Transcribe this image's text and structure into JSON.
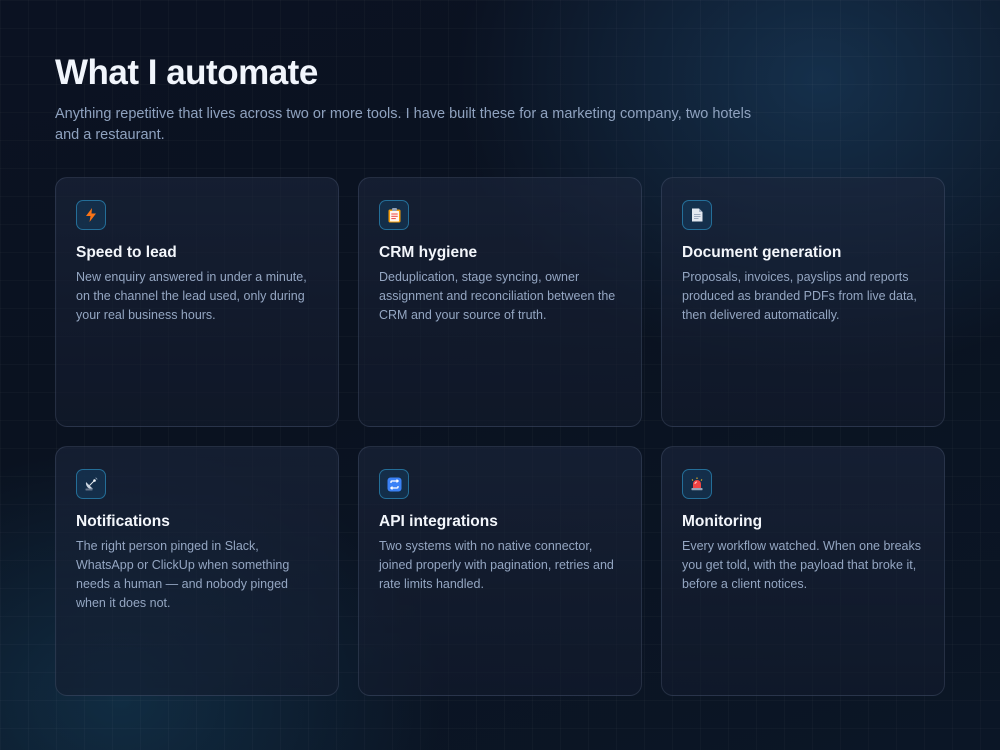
{
  "section": {
    "title": "What I automate",
    "subtitle": "Anything repetitive that lives across two or more tools. I have built these for a marketing company, two hotels and a restaurant."
  },
  "cards": [
    {
      "icon": "lightning-icon",
      "title": "Speed to lead",
      "description": "New enquiry answered in under a minute, on the channel the lead used, only during your real business hours."
    },
    {
      "icon": "clipboard-icon",
      "title": "CRM hygiene",
      "description": "Deduplication, stage syncing, owner assignment and reconciliation between the CRM and your source of truth."
    },
    {
      "icon": "document-icon",
      "title": "Document generation",
      "description": "Proposals, invoices, payslips and reports produced as branded PDFs from live data, then delivered automatically."
    },
    {
      "icon": "satellite-dish-icon",
      "title": "Notifications",
      "description": "The right person pinged in Slack, WhatsApp or ClickUp when something needs a human — and nobody pinged when it does not."
    },
    {
      "icon": "sync-arrows-icon",
      "title": "API integrations",
      "description": "Two systems with no native connector, joined properly with pagination, retries and rate limits handled."
    },
    {
      "icon": "alarm-light-icon",
      "title": "Monitoring",
      "description": "Every workflow watched. When one breaks you get told, with the payload that broke it, before a client notices."
    }
  ],
  "colors": {
    "accent_border": "#38bdf8",
    "background": "#0b1222",
    "heading": "#f1f5fc",
    "body_text": "#94a6c2"
  }
}
